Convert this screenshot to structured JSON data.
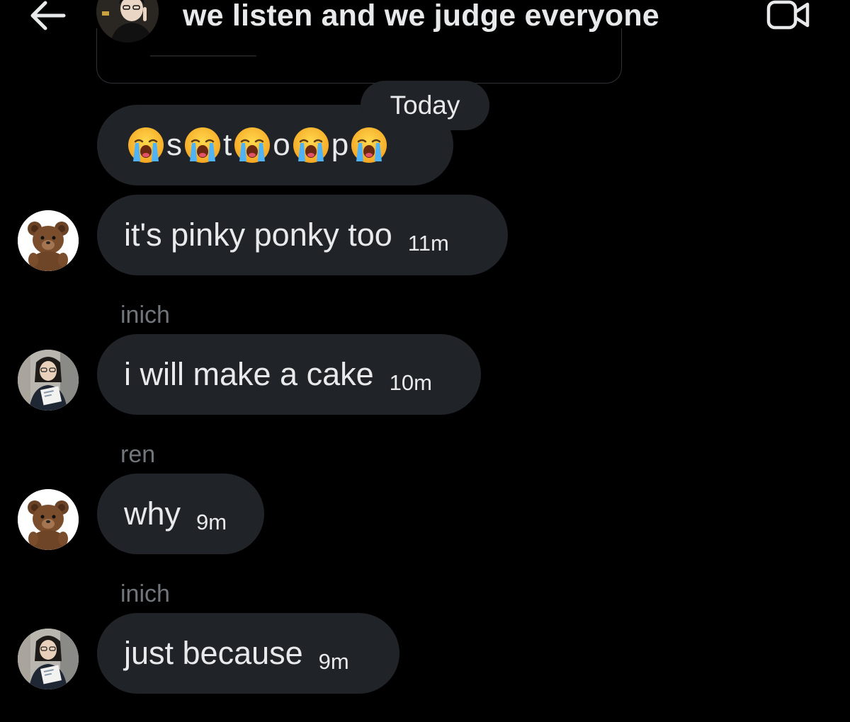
{
  "header": {
    "title": "we listen and we judge everyone",
    "back_icon": "arrow-left-icon",
    "video_icon": "video-camera-icon"
  },
  "divider": {
    "today_label": "Today"
  },
  "messages": [
    {
      "sender": "",
      "letters": [
        "s",
        "t",
        "o",
        "p"
      ],
      "emoji": "loudly-crying-face-emoji",
      "time": ""
    },
    {
      "sender": "",
      "text": "it's pinky ponky too",
      "time": "11m",
      "avatar": "teddy-bear-avatar"
    },
    {
      "sender": "inich",
      "text": "i will make a cake",
      "time": "10m",
      "avatar": "girl-with-glasses-avatar"
    },
    {
      "sender": "ren",
      "text": "why",
      "time": "9m",
      "avatar": "teddy-bear-avatar"
    },
    {
      "sender": "inich",
      "text": "just because",
      "time": "9m",
      "avatar": "girl-with-glasses-avatar"
    }
  ],
  "colors": {
    "background": "#000000",
    "bubble": "#202327",
    "text": "#e7e9ea",
    "muted": "#71767b",
    "border": "#2f3336"
  }
}
